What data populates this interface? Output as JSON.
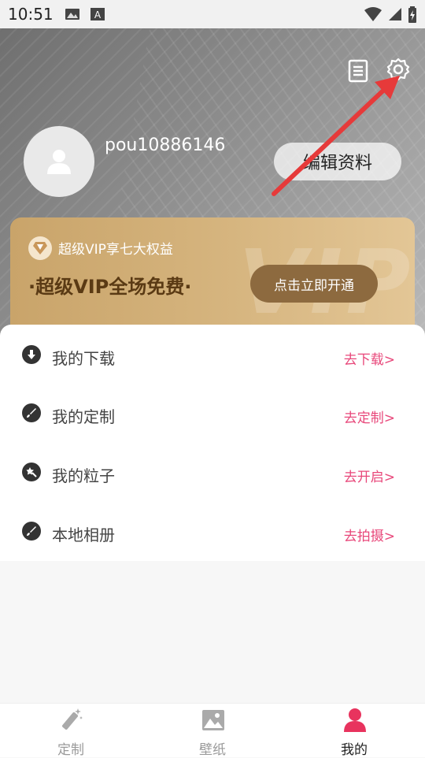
{
  "status_bar": {
    "time": "10:51"
  },
  "profile": {
    "username": "pou10886146",
    "edit_label": "编辑资料"
  },
  "vip": {
    "subtitle": "超级VIP享七大权益",
    "headline": "·超级VIP全场免费·",
    "open_label": "点击立即开通",
    "watermark": "VIP"
  },
  "menu": [
    {
      "icon": "download-icon",
      "label": "我的下载",
      "action": "去下载>"
    },
    {
      "icon": "brush-icon",
      "label": "我的定制",
      "action": "去定制>"
    },
    {
      "icon": "sparkle-wand-icon",
      "label": "我的粒子",
      "action": "去开启>"
    },
    {
      "icon": "brush-icon",
      "label": "本地相册",
      "action": "去拍摄>"
    }
  ],
  "bottom_nav": [
    {
      "icon": "magic-wand-icon",
      "label": "定制"
    },
    {
      "icon": "image-icon",
      "label": "壁纸"
    },
    {
      "icon": "user-icon",
      "label": "我的",
      "active": true
    }
  ],
  "colors": {
    "accent": "#e8477a",
    "vip_gold": "#d6b57f",
    "vip_button": "#8d6a3f"
  }
}
